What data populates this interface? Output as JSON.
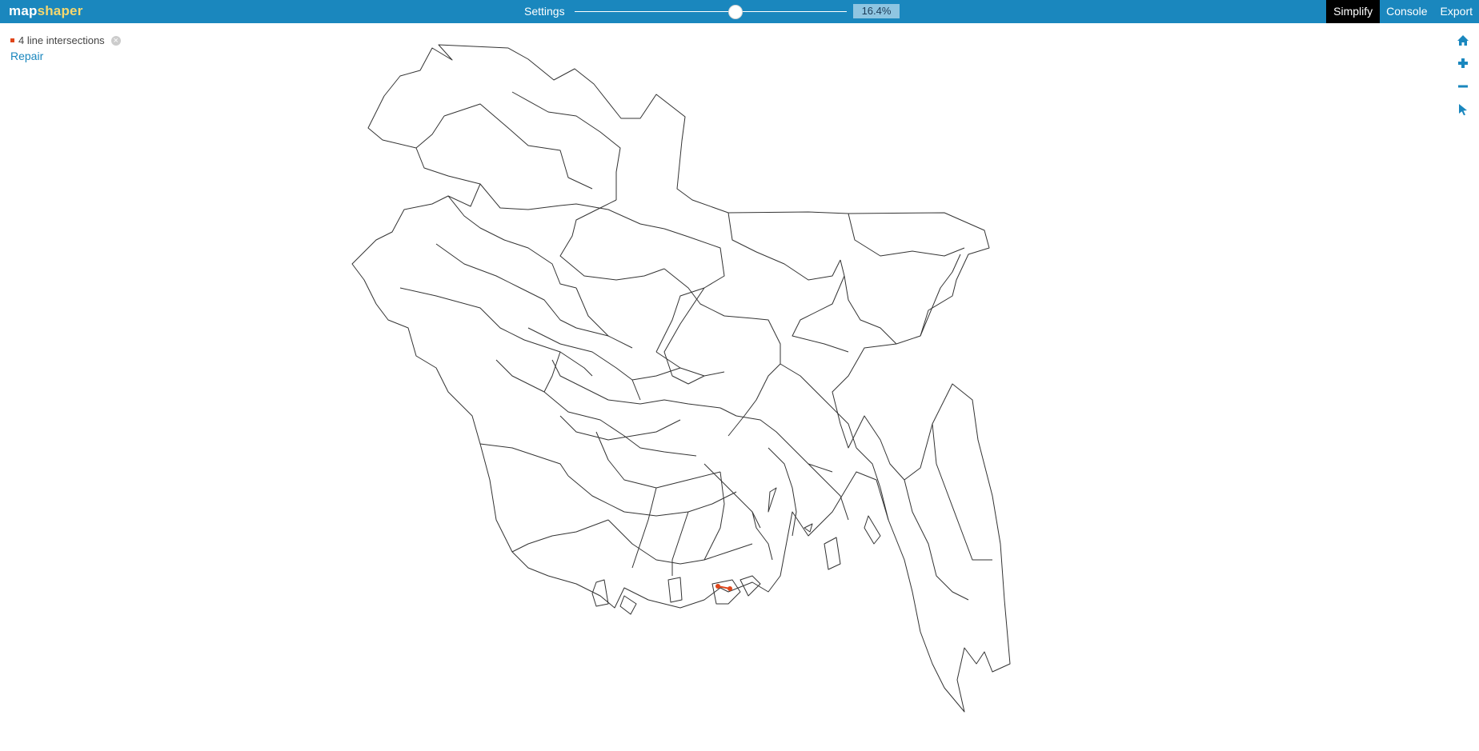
{
  "app": {
    "logo_map": "map",
    "logo_shaper": "shaper"
  },
  "toolbar": {
    "settings_label": "Settings",
    "simplify_percent": "16.4%",
    "simplify_slider_fraction": 0.59,
    "menu": [
      "Simplify",
      "Console",
      "Export"
    ],
    "active_menu": "Simplify"
  },
  "intersections": {
    "label": "4 line intersections",
    "repair_label": "Repair"
  },
  "map_tools": [
    "home-icon",
    "zoom-in-icon",
    "zoom-out-icon",
    "pointer-icon"
  ],
  "colors": {
    "header": "#1a87be",
    "accent": "#1a87be",
    "intersection": "#e0461a",
    "outline": "#333333"
  }
}
